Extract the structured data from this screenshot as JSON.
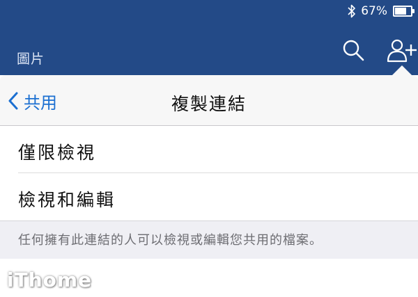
{
  "status_bar": {
    "battery": "67%",
    "battery_level": 0.67,
    "icons": [
      "bluetooth-icon",
      "battery-icon"
    ]
  },
  "app_bar": {
    "folder_label": "圖片",
    "icons": [
      "search-icon",
      "add-person-icon"
    ]
  },
  "popover": {
    "back_label": "共用",
    "title": "複製連結",
    "options": [
      {
        "label": "僅限檢視"
      },
      {
        "label": "檢視和編輯"
      }
    ],
    "footer_text": "任何擁有此連結的人可以檢視或編輯您共用的檔案。"
  },
  "watermark": "iThome",
  "colors": {
    "app_bar": "#234a87",
    "accent": "#1b6fd1",
    "nav_background": "#f7f7f7",
    "footer_background": "#efeff4"
  }
}
